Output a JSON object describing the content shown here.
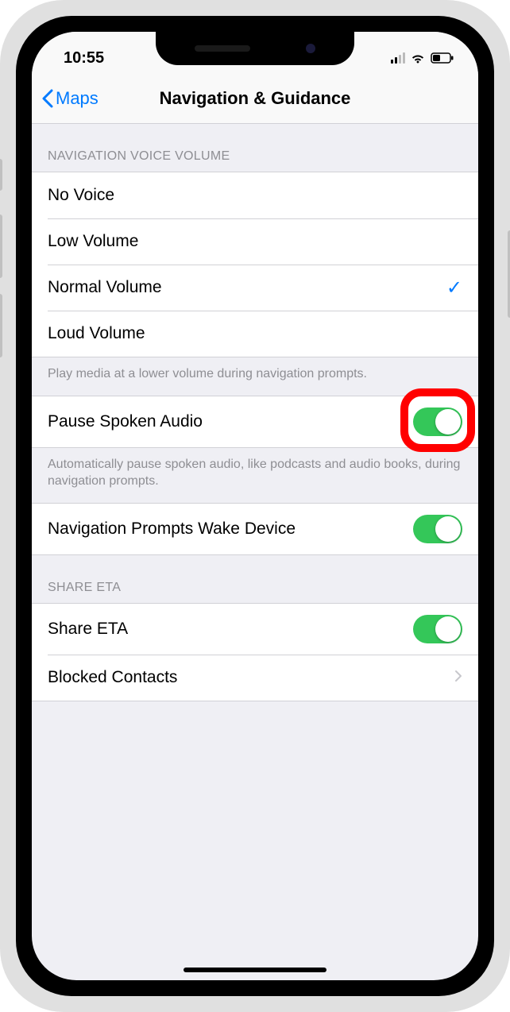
{
  "status": {
    "time": "10:55"
  },
  "nav": {
    "back_label": "Maps",
    "title": "Navigation & Guidance"
  },
  "sections": {
    "voice": {
      "header": "NAVIGATION VOICE VOLUME",
      "options": {
        "no_voice": "No Voice",
        "low": "Low Volume",
        "normal": "Normal Volume",
        "loud": "Loud Volume"
      },
      "selected": "normal",
      "footer": "Play media at a lower volume during navigation prompts."
    },
    "pause": {
      "label": "Pause Spoken Audio",
      "on": true,
      "footer": "Automatically pause spoken audio, like podcasts and audio books, during navigation prompts."
    },
    "wake": {
      "label": "Navigation Prompts Wake Device",
      "on": true
    },
    "share": {
      "header": "SHARE ETA",
      "share_label": "Share ETA",
      "share_on": true,
      "blocked_label": "Blocked Contacts"
    }
  }
}
